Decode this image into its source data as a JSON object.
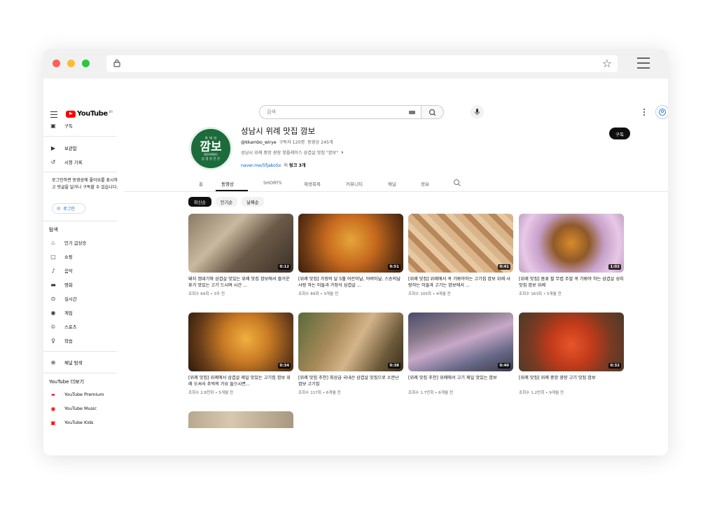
{
  "browser": {
    "url": ""
  },
  "header": {
    "logo_text": "YouTube",
    "logo_country": "KR",
    "search_placeholder": "검색"
  },
  "sidebar": {
    "subscriptions_label": "구독",
    "library_label": "보관함",
    "history_label": "시청 기록",
    "login_prompt": "로그인하면 동영상에 좋아요를 표시하고 댓글을 달거나 구독할 수 있습니다.",
    "login_button": "로그인",
    "explore_heading": "탐색",
    "explore_items": [
      "인기 급상승",
      "쇼핑",
      "음악",
      "영화",
      "실시간",
      "게임",
      "스포츠",
      "학습"
    ],
    "browse_channels": "채널 탐색",
    "more_heading": "YouTube 더보기",
    "more_items": [
      "YouTube Premium",
      "YouTube Music",
      "YouTube Kids"
    ]
  },
  "channel": {
    "avatar_top": "추 억 의",
    "avatar_main": "깜보",
    "avatar_sub": "KKAMBO",
    "avatar_bottom": "삼 겹 살 전 문",
    "title": "성남시 위례 맛집 깜보",
    "handle": "@kkambo_wirye",
    "subscribers": "구독자 120명",
    "video_count": "동영상 245개",
    "description": "성남시 위례 중앙 광장 핫플레이스 삼겹살 맛집 \"깜보\"",
    "description_chevron": "›",
    "link_url": "naver.me/5fjakoSx",
    "link_more_prefix": "외",
    "link_more": "링크 3개",
    "subscribe_button": "구독"
  },
  "tabs": [
    "홈",
    "동영상",
    "SHORTS",
    "재생목록",
    "커뮤니티",
    "채널",
    "정보"
  ],
  "active_tab": "동영상",
  "chips": [
    "최신순",
    "인기순",
    "날짜순"
  ],
  "active_chip": "최신순",
  "videos": [
    {
      "title": "돼지 껍데기와 삼겹살 맛있는 위례 맛집 깜보에서 즐거운 휴가 맛있는 고기 드시며 시간 ...",
      "meta": "조회수 64회 • 3주 전",
      "duration": "0:12"
    },
    {
      "title": "[위례 맛집] 가정의 달 5월 어린이날, 어버이날, 스승의날 사랑 하는 이들과 가정식 삼겹살 ...",
      "meta": "조회수 89회 • 3개월 전",
      "duration": "0:51"
    },
    {
      "title": "[위례 맛집] 위례에서 꼭 가봐야하는 고기집 깜보 위례 사랑하는 이들과 고기는 깜보에서 ...",
      "meta": "조회수 105회 • 4개월 전",
      "duration": "0:41"
    },
    {
      "title": "[위례 맛집] 봄꽃 필 무렵 주말 꼭 가봐야 하는 삼겹살 성지 맛집 깜보 위례",
      "meta": "조회수 163회 • 5개월 전",
      "duration": "1:02"
    },
    {
      "title": "[위례 맛집] 위례에서 삼겹살 제일 맛있는 고기집 깜보 위례 오셔서 추억의 가요 들으시면...",
      "meta": "조회수 2.8천회 • 5개월 전",
      "duration": "0:34"
    },
    {
      "title": "[위례 맛집 추천] 최상급 국내산 삼겹살 맛집으로 소문난 깜보 고기집",
      "meta": "조회수 117회 • 6개월 전",
      "duration": "0:38"
    },
    {
      "title": "[위례 맛집 추천] 위례에서 고기 제일 맛있는 깜보",
      "meta": "조회수 1.7만회 • 6개월 전",
      "duration": "0:40"
    },
    {
      "title": "[위례 맛집] 위례 중앙 광장 고기 맛집 깜보",
      "meta": "조회수 1.2만회 • 9개월 전",
      "duration": "0:32"
    },
    {
      "title": "",
      "meta": "",
      "duration": ""
    }
  ]
}
